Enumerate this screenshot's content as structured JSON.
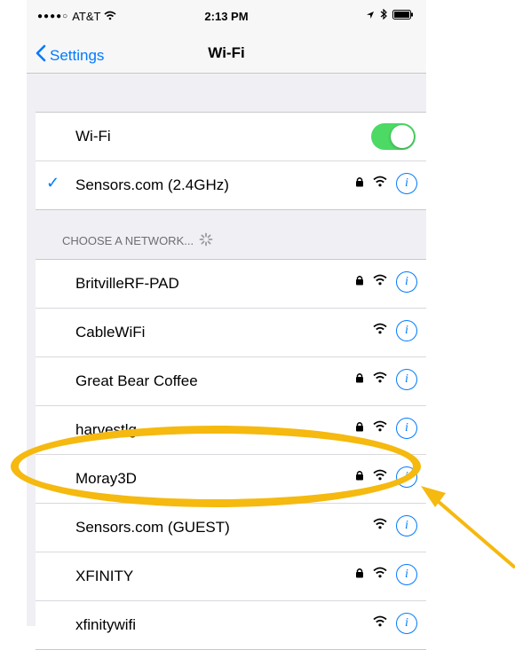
{
  "status_bar": {
    "carrier": "AT&T",
    "time": "2:13 PM"
  },
  "nav": {
    "back_label": "Settings",
    "title": "Wi-Fi"
  },
  "wifi_toggle": {
    "label": "Wi-Fi",
    "enabled": true
  },
  "connected": {
    "name": "Sensors.com (2.4GHz)",
    "secured": true
  },
  "choose_network": {
    "header": "CHOOSE A NETWORK..."
  },
  "networks": [
    {
      "name": "BritvilleRF-PAD",
      "secured": true
    },
    {
      "name": "CableWiFi",
      "secured": false
    },
    {
      "name": "Great Bear Coffee",
      "secured": true
    },
    {
      "name": "harvestlg",
      "secured": true
    },
    {
      "name": "Moray3D",
      "secured": true
    },
    {
      "name": "Sensors.com (GUEST)",
      "secured": false
    },
    {
      "name": "XFINITY",
      "secured": true
    },
    {
      "name": "xfinitywifi",
      "secured": false
    }
  ],
  "colors": {
    "accent": "#007aff",
    "toggle_on": "#4cd964",
    "highlight": "#f5b90f"
  },
  "icons": [
    "lock-icon",
    "wifi-icon",
    "info-icon",
    "checkmark-icon",
    "spinner-icon",
    "battery-icon",
    "bluetooth-icon",
    "location-icon"
  ]
}
